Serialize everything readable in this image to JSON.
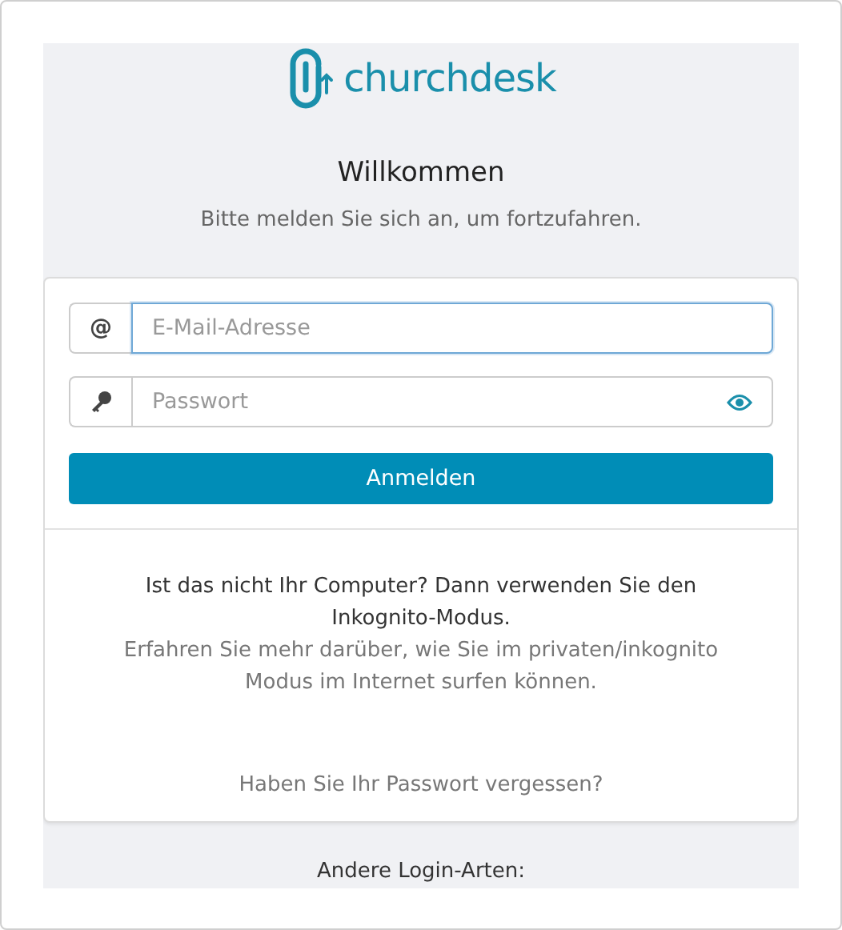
{
  "logo": {
    "text": "churchdesk"
  },
  "heading": "Willkommen",
  "subtitle": "Bitte melden Sie sich an, um fortzufahren.",
  "fields": [
    {
      "kind": "email",
      "addon": "@",
      "placeholder": "E-Mail-Adresse",
      "focused": true
    },
    {
      "kind": "password",
      "placeholder": "Passwort",
      "focused": false
    }
  ],
  "submit_button": "Anmelden",
  "incognito_notice": "Ist das nicht Ihr Computer? Dann verwenden Sie den Inkognito-Modus.",
  "incognito_link": "Erfahren Sie mehr darüber, wie Sie im privaten/inkognito Modus im Internet surfen können.",
  "forgot_password_link": "Haben Sie Ihr Passwort vergessen?",
  "other_logins_label": "Andere Login-Arten:"
}
